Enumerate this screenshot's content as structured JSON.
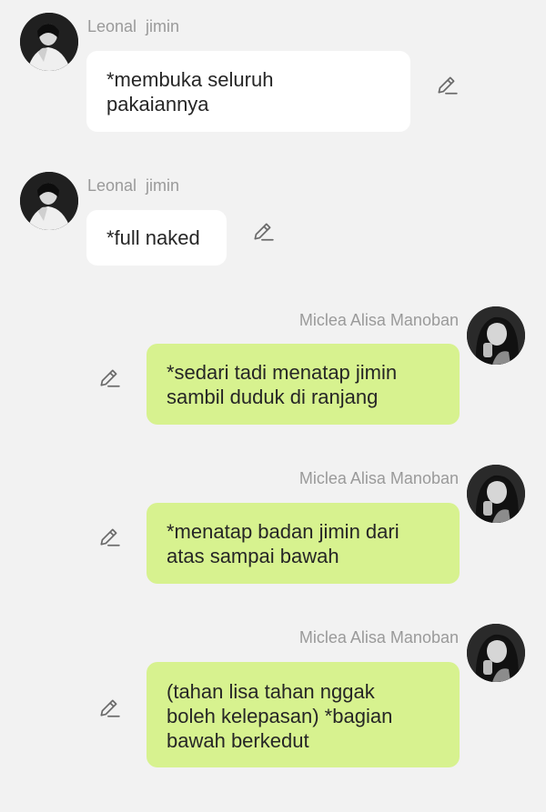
{
  "messages": [
    {
      "sender": "Leonal  jimin",
      "side": "incoming",
      "text": "*membuka seluruh\npakaiannya",
      "avatar_icon": "leonal-jimin-avatar",
      "action_icon": "pencil-icon"
    },
    {
      "sender": "Leonal  jimin",
      "side": "incoming",
      "text": "*full naked",
      "avatar_icon": "leonal-jimin-avatar",
      "action_icon": "pencil-icon"
    },
    {
      "sender": "Miclea Alisa Manoban",
      "side": "outgoing",
      "text": "*sedari tadi menatap jimin\nsambil duduk di ranjang",
      "avatar_icon": "miclea-alisa-avatar",
      "action_icon": "pencil-icon"
    },
    {
      "sender": "Miclea Alisa Manoban",
      "side": "outgoing",
      "text": "*menatap badan jimin dari\natas sampai bawah",
      "avatar_icon": "miclea-alisa-avatar",
      "action_icon": "pencil-icon"
    },
    {
      "sender": "Miclea Alisa Manoban",
      "side": "outgoing",
      "text": "(tahan lisa tahan nggak\nboleh kelepasan) *bagian\nbawah berkedut",
      "avatar_icon": "miclea-alisa-avatar",
      "action_icon": "pencil-icon"
    }
  ],
  "colors": {
    "background": "#f2f2f2",
    "incoming_bubble": "#ffffff",
    "outgoing_bubble": "#d7f28f",
    "sender_name": "#9a9a9a",
    "message_text": "#262626",
    "icon": "#6b6b6b"
  }
}
